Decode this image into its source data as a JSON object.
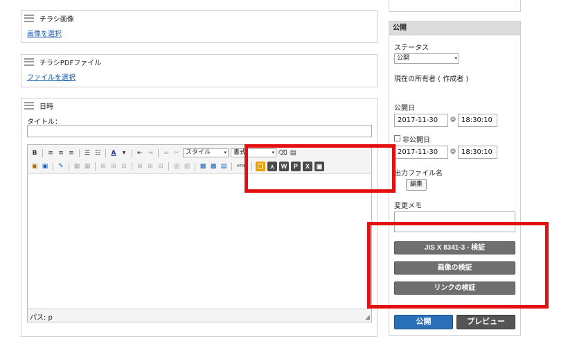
{
  "flyer_image": {
    "title": "チラシ画像",
    "link": "画像を選択"
  },
  "flyer_pdf": {
    "title": "チラシPDFファイル",
    "link": "ファイルを選択"
  },
  "datetime_panel": {
    "title": "日時",
    "title_label": "タイトル：",
    "title_value": "",
    "editor": {
      "style_combo": "スタイル",
      "format_combo": "書式",
      "path_label": "パス: p",
      "icons_row1": [
        "bold-icon",
        "align-left-icon",
        "align-center-icon",
        "align-right-icon",
        "bullet-list-icon",
        "number-list-icon",
        "font-color-icon",
        "outdent-icon",
        "indent-icon",
        "link-icon",
        "unlink-icon",
        "clear-format-icon",
        "paste-plain-icon"
      ],
      "export_icons": [
        "copy-icon",
        "pdf-icon",
        "word-icon",
        "powerpoint-icon",
        "excel-icon",
        "image-export-icon"
      ]
    }
  },
  "publish": {
    "header": "公開",
    "status_label": "ステータス",
    "status_value": "公開",
    "owner_label": "現在の所有者 ( 作成者 )",
    "publish_date_label": "公開日",
    "publish_date": "2017-11-30",
    "publish_time": "18:30:10",
    "unpublish_label": "非公開日",
    "unpublish_date": "2017-11-30",
    "unpublish_time": "18:30:10",
    "at_sign": "@",
    "output_file_label": "出力ファイル名",
    "edit_button": "編集",
    "change_memo_label": "変更メモ",
    "change_memo_value": "",
    "check_jis": "JIS X 8341-3 - 検証",
    "check_image": "画像の検証",
    "check_link": "リンクの検証",
    "publish_button": "公開",
    "preview_button": "プレビュー"
  },
  "colors": {
    "highlight": "#e31010",
    "publish_blue": "#2a70b8",
    "check_gray": "#6f6f6f",
    "dark_gray": "#555555"
  }
}
